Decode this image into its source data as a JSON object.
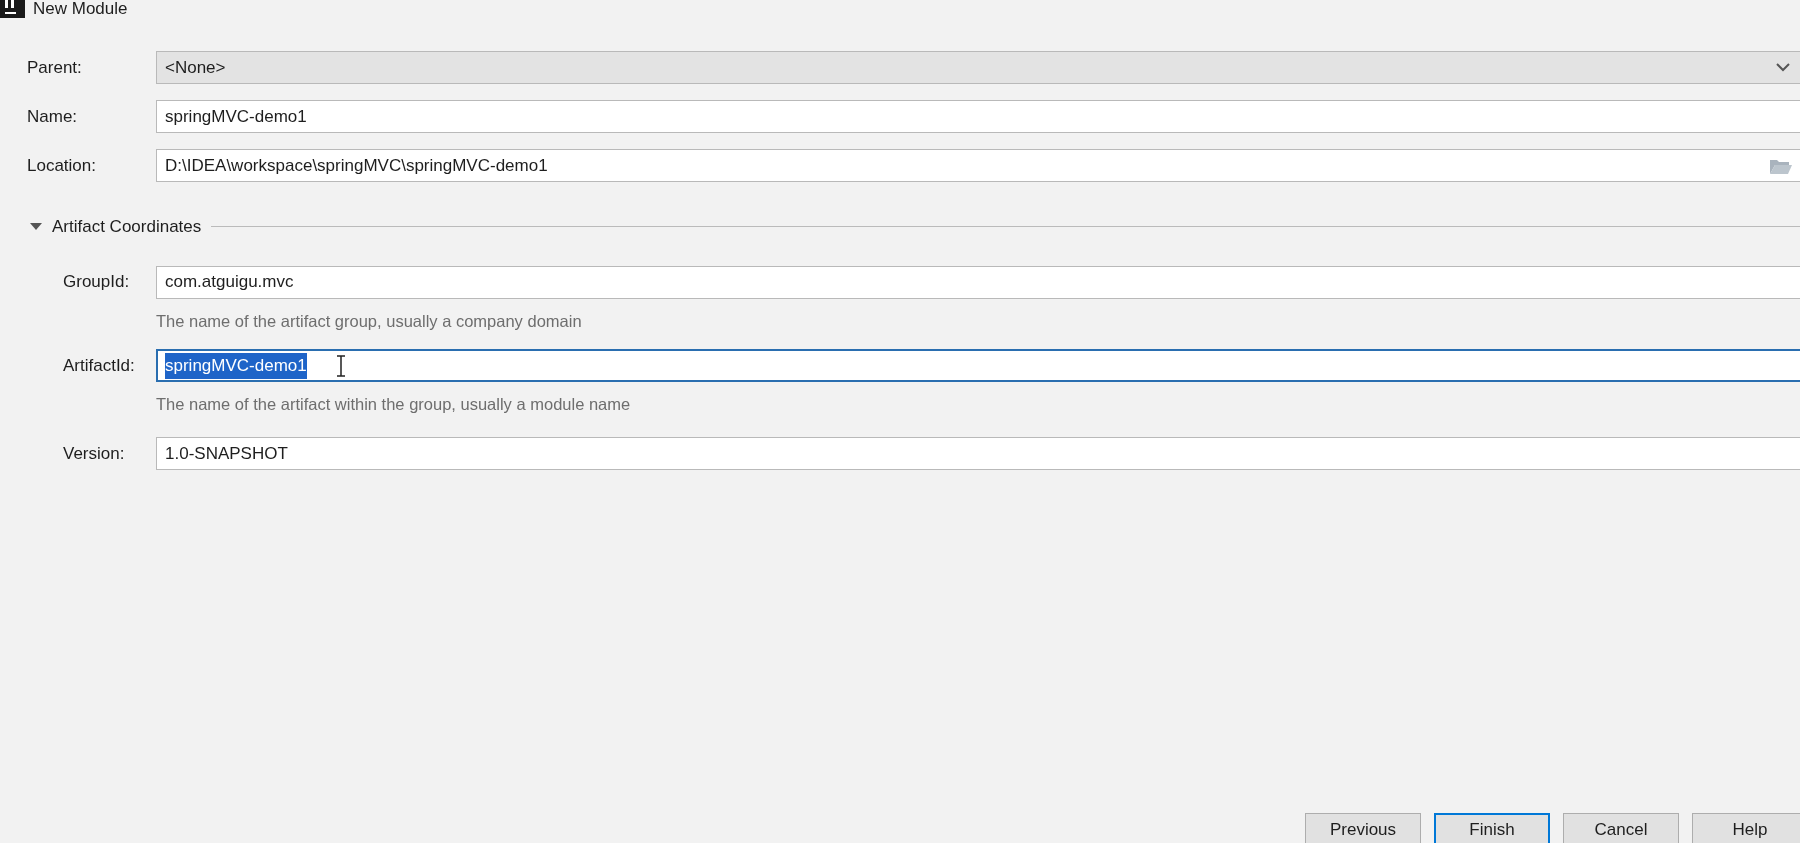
{
  "window": {
    "title": "New Module"
  },
  "fields": [
    {
      "label": "Parent:",
      "kind": "dropdown",
      "value": "<None>"
    },
    {
      "label": "Name:",
      "kind": "text",
      "value": "springMVC-demo1"
    },
    {
      "label": "Location:",
      "kind": "path",
      "value": "D:\\IDEA\\workspace\\springMVC\\springMVC-demo1"
    }
  ],
  "section": {
    "title": "Artifact Coordinates",
    "expanded": true,
    "fields": [
      {
        "label": "GroupId:",
        "value": "com.atguigu.mvc",
        "hint": "The name of the artifact group, usually a company domain",
        "focused": false,
        "text_selected": false
      },
      {
        "label": "ArtifactId:",
        "value": "springMVC-demo1",
        "hint": "The name of the artifact within the group, usually a module name",
        "focused": true,
        "text_selected": true
      },
      {
        "label": "Version:",
        "value": "1.0-SNAPSHOT",
        "focused": false,
        "text_selected": false
      }
    ]
  },
  "buttons": [
    {
      "label": "Previous",
      "default": false
    },
    {
      "label": "Finish",
      "default": true
    },
    {
      "label": "Cancel",
      "default": false
    },
    {
      "label": "Help",
      "default": false
    }
  ]
}
